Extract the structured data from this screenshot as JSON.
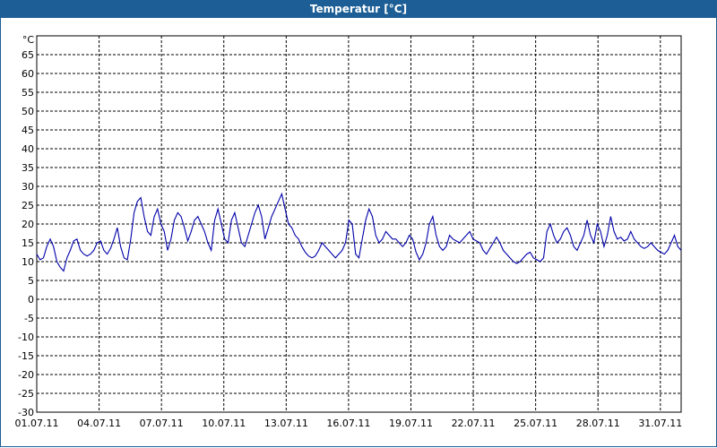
{
  "window": {
    "title": "Temperatur [°C]"
  },
  "colors": {
    "titlebar": "#1c5e95",
    "series": "#0000aa",
    "grid": "#000000"
  },
  "chart_data": {
    "type": "line",
    "title": "Temperatur [°C]",
    "ylabel": "°C",
    "ylim": [
      -30,
      70
    ],
    "yticks": [
      -30,
      -25,
      -20,
      -15,
      -10,
      -5,
      0,
      5,
      10,
      15,
      20,
      25,
      30,
      35,
      40,
      45,
      50,
      55,
      60,
      65
    ],
    "xlim": [
      "2011-07-01",
      "2011-08-01"
    ],
    "xticks": [
      "01.07.11",
      "04.07.11",
      "07.07.11",
      "10.07.11",
      "13.07.11",
      "16.07.11",
      "19.07.11",
      "22.07.11",
      "25.07.11",
      "28.07.11",
      "31.07.11"
    ],
    "grid": true,
    "series": [
      {
        "x_start": "2011-07-01",
        "values": [
          12,
          10.5,
          11,
          14,
          16,
          14,
          10,
          8.5,
          7.5,
          11,
          13,
          15.5,
          16,
          13,
          12,
          11.5,
          12,
          13,
          15,
          15.5,
          13,
          12,
          13.5,
          16,
          19,
          14,
          11,
          10.5,
          16,
          23,
          26,
          27,
          22,
          18,
          17,
          22,
          24,
          20,
          18,
          13,
          16,
          21,
          23,
          22,
          19,
          15.5,
          18,
          21,
          22,
          20,
          18,
          15,
          13,
          21,
          24,
          20,
          16,
          15,
          21,
          23,
          19,
          15,
          14,
          17,
          20,
          23,
          25,
          22,
          16,
          19,
          22,
          24,
          26,
          28,
          24,
          20,
          19,
          17,
          16,
          14,
          12.5,
          11.5,
          11,
          11.5,
          13,
          15,
          14,
          13,
          12,
          11,
          12,
          13,
          15,
          21,
          20,
          12,
          11,
          16,
          21,
          24,
          22,
          17,
          15,
          16,
          18,
          17,
          16,
          16,
          15,
          14,
          15,
          17,
          16,
          12.5,
          10.5,
          12,
          15,
          20,
          22,
          17,
          14,
          13,
          14,
          17,
          16,
          15.5,
          15,
          16,
          17,
          18,
          16,
          15.5,
          15,
          13,
          12,
          13.5,
          15,
          16.5,
          15,
          13,
          12,
          11,
          10,
          9.5,
          10,
          11,
          12,
          12.5,
          11,
          10.5,
          10,
          11,
          18,
          20,
          17,
          15,
          16,
          18,
          19,
          17,
          14,
          13,
          15,
          17,
          21,
          17,
          15,
          20,
          18,
          14,
          17,
          22,
          18,
          16,
          16.5,
          15.5,
          16,
          18,
          16,
          15,
          14,
          13.5,
          14,
          15,
          14,
          13,
          12.5,
          12,
          13,
          15,
          17,
          14,
          13
        ]
      }
    ]
  }
}
